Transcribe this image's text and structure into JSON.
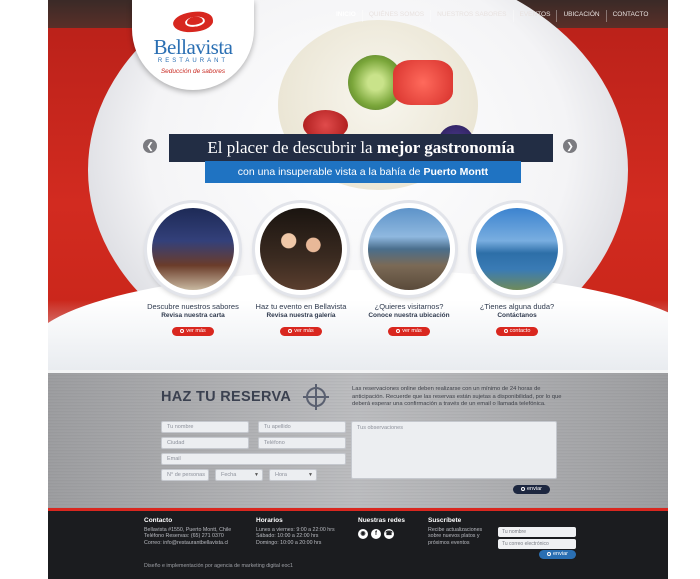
{
  "nav": [
    "INICIO",
    "QUIÉNES SOMOS",
    "NUESTROS SABORES",
    "EVENTOS",
    "UBICACIÓN",
    "CONTACTO"
  ],
  "logo": {
    "name": "Bellavista",
    "sub": "RESTAURANT",
    "tagline": "Seducción de sabores"
  },
  "hero": {
    "title_plain": "El placer de descubrir la ",
    "title_bold": "mejor gastronomía",
    "subtitle_plain": "con una insuperable vista a la bahía de ",
    "subtitle_bold": "Puerto Montt"
  },
  "features": [
    {
      "line1": "Descubre nuestros sabores",
      "line2": "Revisa nuestra carta",
      "button": "ver más"
    },
    {
      "line1": "Haz tu evento en Bellavista",
      "line2": "Revisa nuestra galería",
      "button": "ver más"
    },
    {
      "line1": "¿Quieres visitarnos?",
      "line2": "Conoce nuestra ubicación",
      "button": "ver más"
    },
    {
      "line1": "¿Tienes alguna duda?",
      "line2": "Contáctanos",
      "button": "contacto"
    }
  ],
  "reserva": {
    "title": "HAZ TU RESERVA",
    "info": "Las reservaciones online deben realizarse con un mínimo de 24 horas de anticipación. Recuerde que las reservas están sujetas a disponibilidad, por lo que deberá esperar una confirmación a través de un email o llamada telefónica.",
    "placeholders": {
      "nombre": "Tu nombre",
      "apellido": "Tu apellido",
      "ciudad": "Ciudad",
      "telefono": "Teléfono",
      "email": "Email",
      "personas": "N° de personas",
      "fecha": "Fecha",
      "hora": "Hora",
      "observaciones": "Tus observaciones"
    },
    "submit": "enviar"
  },
  "footer": {
    "contacto": {
      "heading": "Contacto",
      "lines": [
        "Bellavista #1550, Puerto Montt, Chile",
        "Teléfono Reservas: (65) 271 0370",
        "Correo: info@restaurantbellavista.cl"
      ]
    },
    "horarios": {
      "heading": "Horarios",
      "lines": [
        "Lunes a viernes: 9:00 a 22:00 hrs",
        "Sábado: 10:00 a 22:00 hrs",
        "Domingo: 10:00 a 20:00 hrs"
      ]
    },
    "redes": {
      "heading": "Nuestras redes",
      "icons": [
        "instagram-icon",
        "facebook-icon",
        "whatsapp-icon"
      ]
    },
    "suscribete": {
      "heading": "Suscríbete",
      "lines": [
        "Recibe actualizaciones",
        "sobre nuevos platos y",
        "próximos eventos"
      ],
      "name_placeholder": "Tu nombre",
      "email_placeholder": "Tu correo electrónico",
      "button": "enviar"
    },
    "credits": "Diseño e implementación por agencia de marketing digital eoc1"
  },
  "colors": {
    "brand_red": "#d9271f",
    "navy": "#222d44",
    "blue": "#1f73c2",
    "footer": "#1b1c1f"
  }
}
